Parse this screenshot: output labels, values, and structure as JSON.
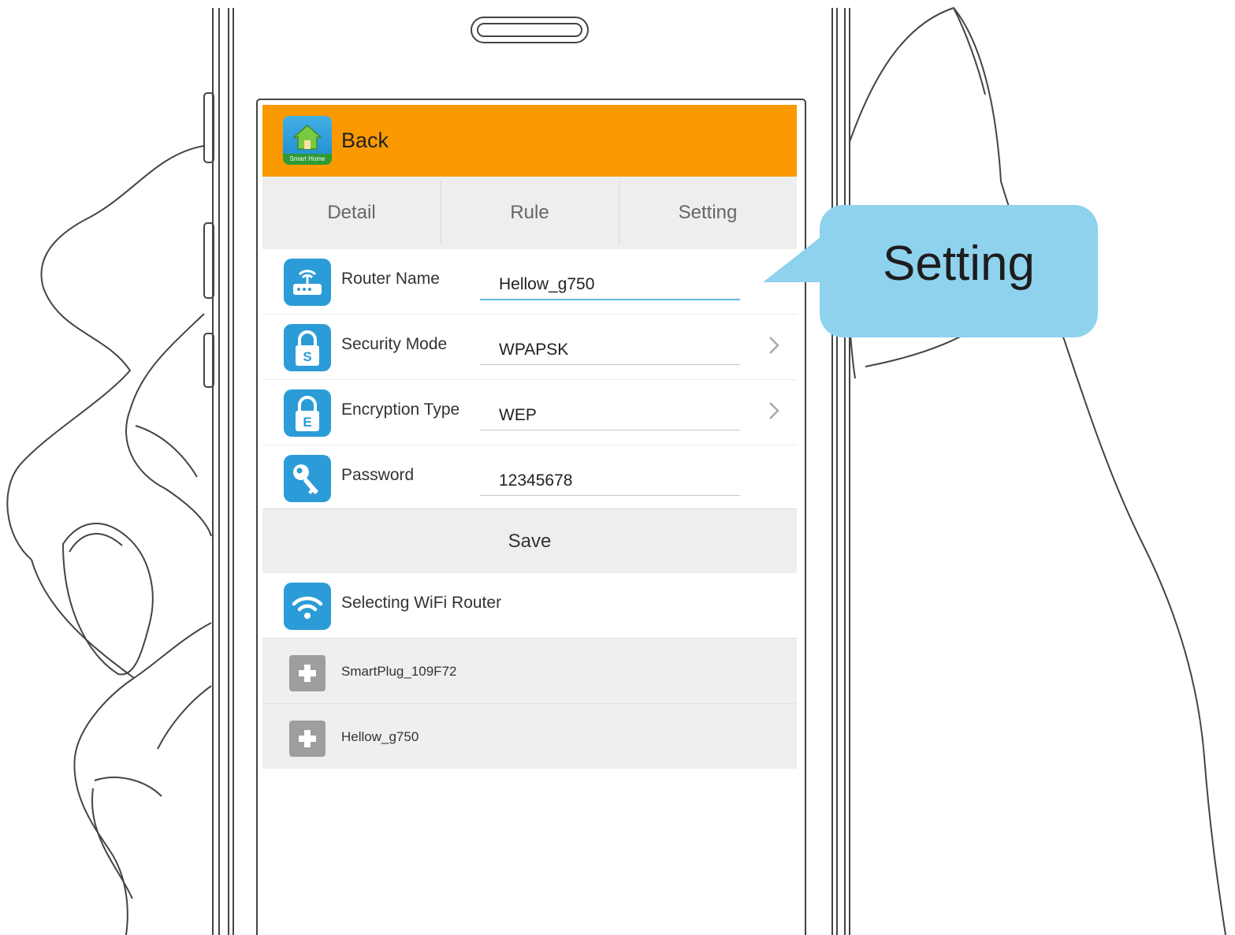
{
  "header": {
    "back_label": "Back",
    "app_icon_caption": "Smart Home"
  },
  "tabs": [
    {
      "label": "Detail"
    },
    {
      "label": "Rule"
    },
    {
      "label": "Setting"
    }
  ],
  "fields": [
    {
      "label": "Router Name",
      "value": "Hellow_g750",
      "icon": "router-icon"
    },
    {
      "label": "Security Mode",
      "value": "WPAPSK",
      "icon": "lock-s-icon"
    },
    {
      "label": "Encryption Type",
      "value": "WEP",
      "icon": "lock-e-icon"
    },
    {
      "label": "Password",
      "value": "12345678",
      "icon": "key-icon"
    }
  ],
  "save_label": "Save",
  "wifi": {
    "label": "Selecting WiFi Router",
    "icon": "wifi-icon"
  },
  "devices": [
    {
      "label": "SmartPlug_109F72"
    },
    {
      "label": "Hellow_g750"
    }
  ],
  "callout": {
    "text": "Setting"
  },
  "colors": {
    "header": "#fa9900",
    "accent_blue": "#2b9cd7",
    "callout": "#8fd2ee"
  }
}
